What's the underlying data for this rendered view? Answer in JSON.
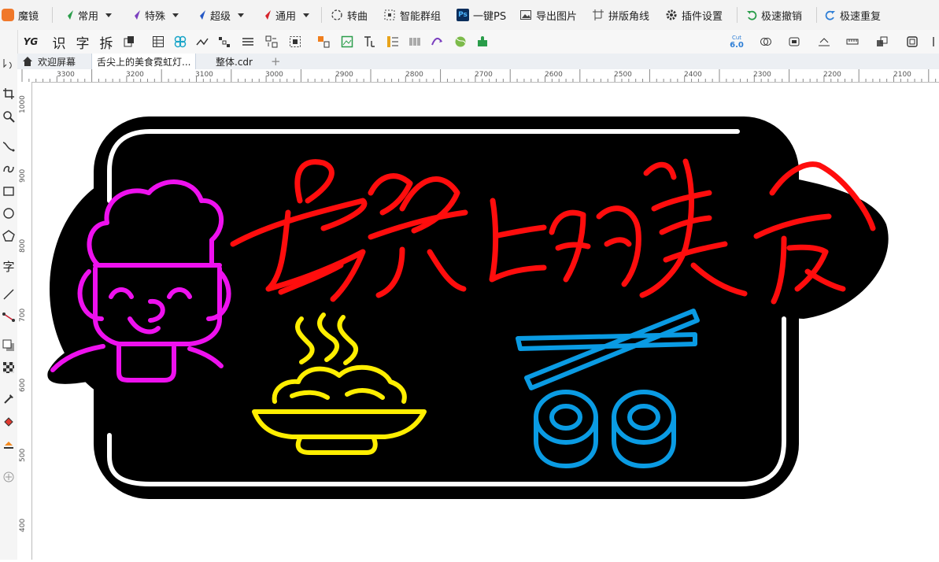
{
  "topbar": {
    "items": [
      {
        "label": "魔镜",
        "has_caret": false
      },
      {
        "label": "常用",
        "has_caret": true
      },
      {
        "label": "特殊",
        "has_caret": true
      },
      {
        "label": "超级",
        "has_caret": true
      },
      {
        "label": "通用",
        "has_caret": true
      },
      {
        "label": "转曲",
        "has_caret": false
      },
      {
        "label": "智能群组",
        "has_caret": false
      },
      {
        "label": "一键PS",
        "has_caret": false
      },
      {
        "label": "导出图片",
        "has_caret": false
      },
      {
        "label": "拼版角线",
        "has_caret": false
      },
      {
        "label": "插件设置",
        "has_caret": false
      },
      {
        "label": "极速撤销",
        "has_caret": false
      },
      {
        "label": "极速重复",
        "has_caret": false
      }
    ],
    "ps_badge": "Ps",
    "colors": {
      "green": "#2a9d4a",
      "purple": "#7b3fbf",
      "blue": "#2457c5",
      "red": "#d6232b",
      "orange": "#f0782a"
    }
  },
  "toolbar2": {
    "text_tools": [
      "识",
      "字",
      "拆"
    ],
    "cut_badge_top": "Cut",
    "cut_badge_bottom": "6.0"
  },
  "tabs": [
    {
      "label": "欢迎屏幕",
      "active": false
    },
    {
      "label": "舌尖上的美食霓虹灯...",
      "active": true
    },
    {
      "label": "整体.cdr",
      "active": false
    }
  ],
  "add_tab": "+",
  "toolbox": {
    "text_tool": "字"
  },
  "ruler": {
    "h_ticks": [
      "3300",
      "3200",
      "3100",
      "3000",
      "2900",
      "2800",
      "2700",
      "2600",
      "2500",
      "2400",
      "2300",
      "2200",
      "2100"
    ],
    "v_ticks": [
      "1000",
      "900",
      "800",
      "700",
      "600",
      "500",
      "400"
    ]
  },
  "artwork": {
    "title": "舌尖上的美食",
    "colors": {
      "board": "#000000",
      "frame": "#ffffff",
      "title": "#ff0d0d",
      "chef": "#ee11ee",
      "bowl": "#ffee00",
      "sushi": "#0a9be3"
    }
  }
}
